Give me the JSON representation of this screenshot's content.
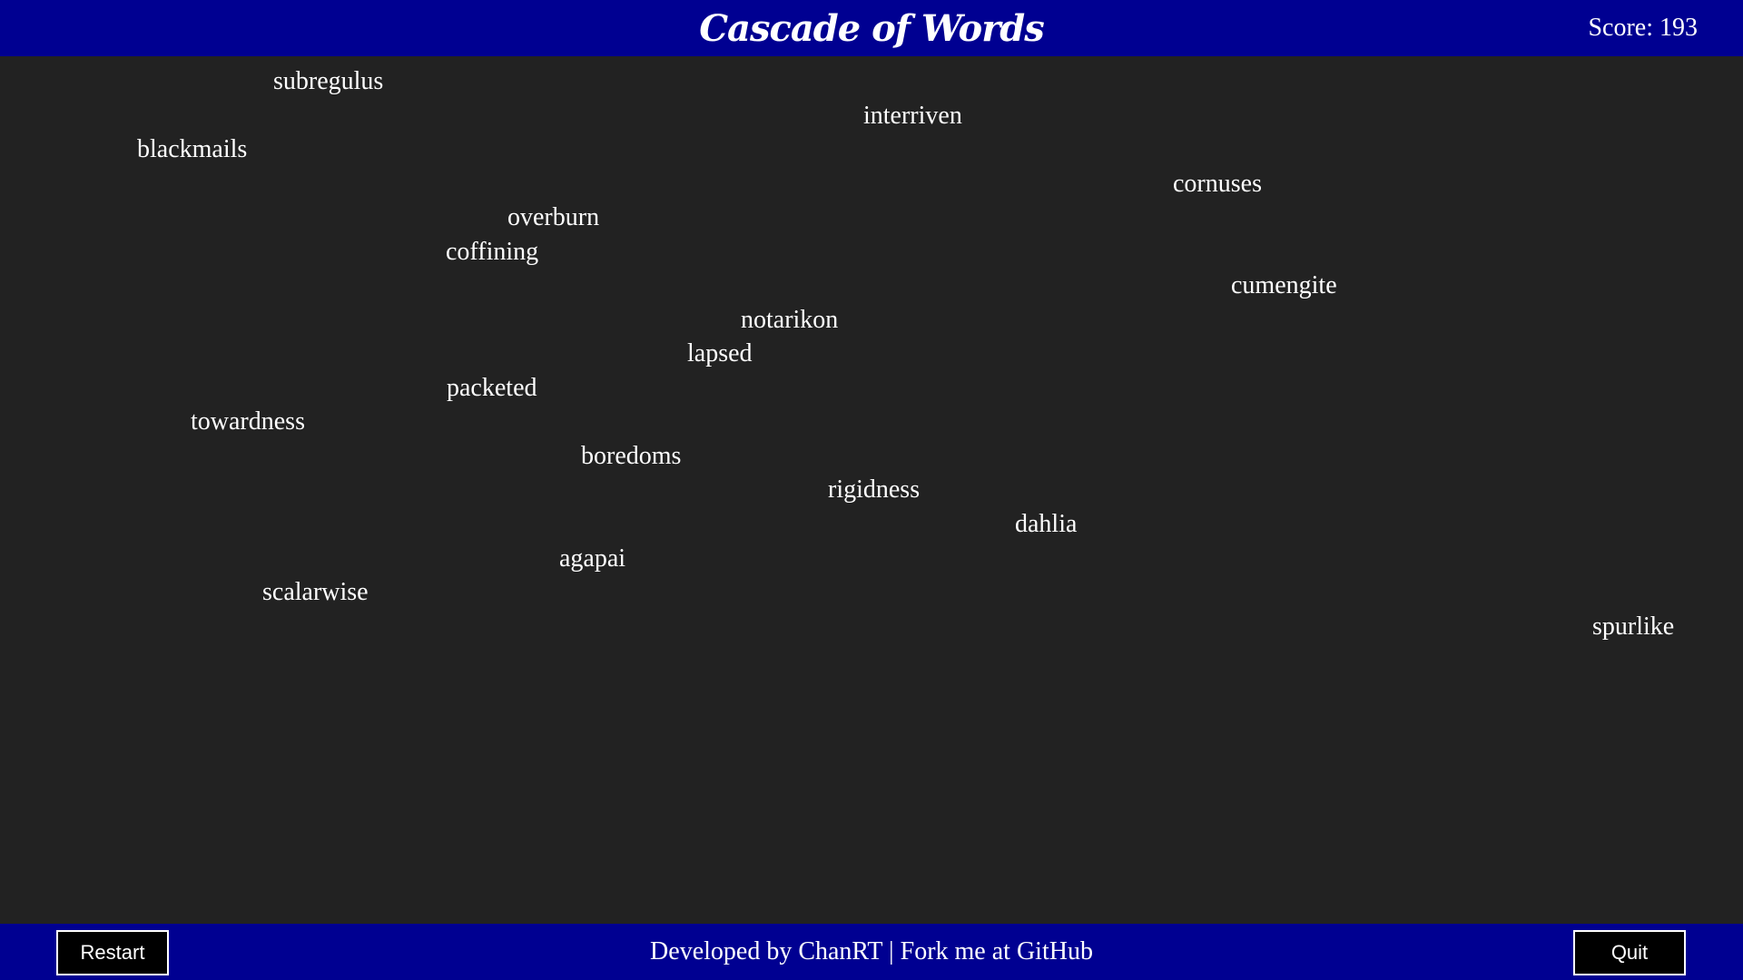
{
  "header": {
    "title": "Cascade of Words",
    "score_text": "Score: 193"
  },
  "words": [
    "subregulus",
    "interriven",
    "blackmails",
    "cornuses",
    "overburn",
    "coffining",
    "cumengite",
    "notarikon",
    "lapsed",
    "packeted",
    "towardness",
    "boredoms",
    "rigidness",
    "dahlia",
    "agapai",
    "scalarwise",
    "spurlike"
  ],
  "footer": {
    "restart_label": "Restart",
    "credits_text": "Developed by ChanRT | Fork me at GitHub",
    "quit_label": "Quit"
  },
  "colors": {
    "bar_background": "#000091",
    "playfield_background": "#222222",
    "text": "#ffffff"
  }
}
